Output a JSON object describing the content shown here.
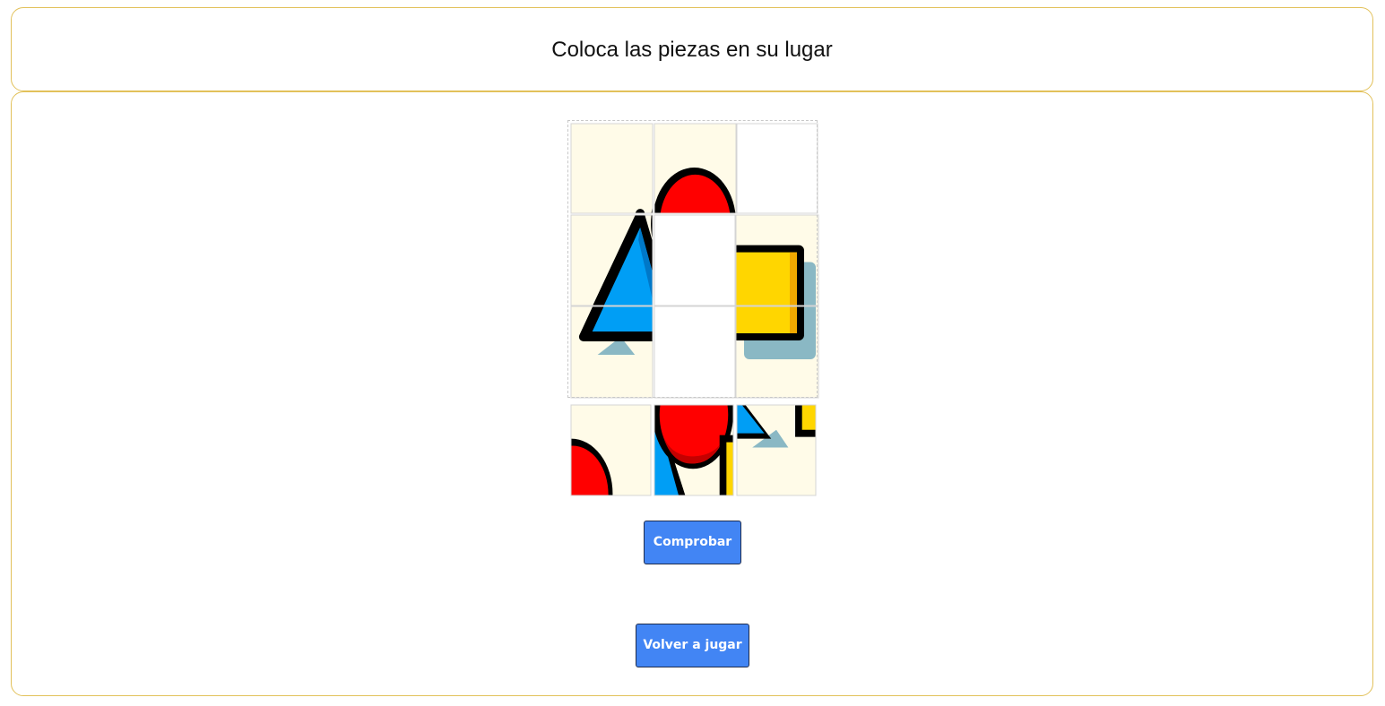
{
  "header": {
    "title": "Coloca las piezas en su lugar"
  },
  "puzzle": {
    "grid": {
      "rows": 3,
      "cols": 3
    },
    "image_colors": {
      "background": "#fffbe8",
      "outline": "#000000",
      "circle": "#ff0000",
      "circle_shade": "#c40000",
      "triangle": "#009ef5",
      "square": "#ffd600",
      "square_shade": "#f2a900",
      "shadow": "#8ab8c4"
    },
    "icons": [
      "triangle-shape-icon",
      "circle-shape-icon",
      "square-shape-icon"
    ]
  },
  "buttons": {
    "check_label": "Comprobar",
    "replay_label": "Volver a jugar"
  },
  "colors": {
    "panel_border": "#e2c15a",
    "button_bg": "#4285f4",
    "button_text": "#ffffff"
  }
}
